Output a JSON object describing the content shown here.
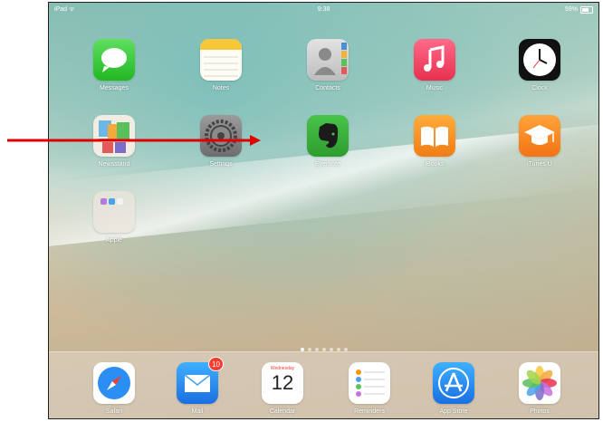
{
  "status_bar": {
    "carrier": "iPad ᯤ",
    "time": "9:38",
    "battery_text": "59%",
    "battery_level": 0.59
  },
  "home_apps": [
    {
      "label": "Messages",
      "icon": "messages-icon"
    },
    {
      "label": "Notes",
      "icon": "notes-icon"
    },
    {
      "label": "Contacts",
      "icon": "contacts-icon"
    },
    {
      "label": "Music",
      "icon": "music-icon"
    },
    {
      "label": "Clock",
      "icon": "clock-icon"
    },
    {
      "label": "Newsstand",
      "icon": "newsstand-icon"
    },
    {
      "label": "Settings",
      "icon": "settings-icon"
    },
    {
      "label": "Evernote",
      "icon": "evernote-icon"
    },
    {
      "label": "iBooks",
      "icon": "ibooks-icon"
    },
    {
      "label": "iTunes U",
      "icon": "itunes-u-icon"
    },
    {
      "label": "Apple",
      "icon": "folder-icon"
    }
  ],
  "page_indicator": {
    "count": 7,
    "active": 0
  },
  "dock_apps": [
    {
      "label": "Safari",
      "icon": "safari-icon"
    },
    {
      "label": "Mail",
      "icon": "mail-icon",
      "badge": "10"
    },
    {
      "label": "Calendar",
      "icon": "calendar-icon",
      "day_name": "Wednesday",
      "day_number": "12"
    },
    {
      "label": "Reminders",
      "icon": "reminders-icon"
    },
    {
      "label": "App Store",
      "icon": "app-store-icon"
    },
    {
      "label": "Photos",
      "icon": "photos-icon"
    }
  ],
  "annotation": {
    "arrow_color": "#e00000",
    "points_to": "Settings"
  }
}
